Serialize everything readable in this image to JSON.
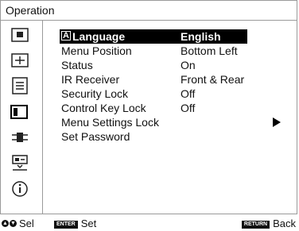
{
  "window": {
    "title": "Operation"
  },
  "sidebar": {
    "items": [
      {
        "icon": "picture-icon"
      },
      {
        "icon": "screen-adjust-icon"
      },
      {
        "icon": "function-icon"
      },
      {
        "icon": "operation-icon",
        "selected": true
      },
      {
        "icon": "connection-icon"
      },
      {
        "icon": "installation-icon"
      },
      {
        "icon": "information-icon"
      }
    ]
  },
  "menu": {
    "rows": [
      {
        "label": "Language",
        "value": "English",
        "selected": true,
        "icon": "language-icon"
      },
      {
        "label": "Menu Position",
        "value": "Bottom Left"
      },
      {
        "label": "Status",
        "value": "On"
      },
      {
        "label": "IR Receiver",
        "value": "Front & Rear"
      },
      {
        "label": "Security Lock",
        "value": "Off"
      },
      {
        "label": "Control Key Lock",
        "value": "Off"
      },
      {
        "label": "Menu Settings Lock",
        "value": "",
        "submenu": true
      },
      {
        "label": "Set Password",
        "value": ""
      }
    ]
  },
  "footer": {
    "select_label": "Sel",
    "enter_key": "ENTER",
    "set_label": "Set",
    "return_key": "RETURN",
    "back_label": "Back"
  }
}
